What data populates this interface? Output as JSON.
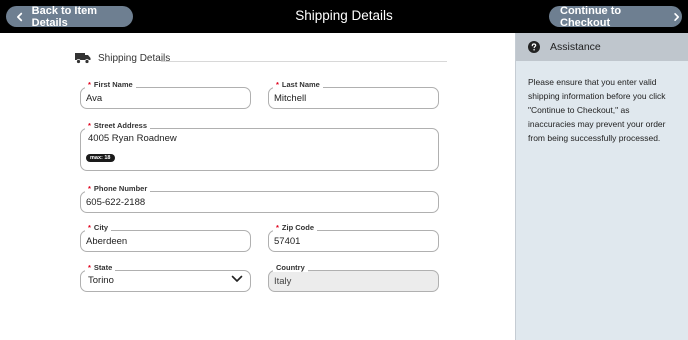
{
  "header": {
    "title": "Shipping Details",
    "back_label": "Back to Item Details",
    "next_label": "Continue to Checkout"
  },
  "form": {
    "section_title": "Shipping Details",
    "first_name": {
      "label": "First Name",
      "value": "Ava",
      "required": true
    },
    "last_name": {
      "label": "Last Name",
      "value": "Mitchell",
      "required": true
    },
    "street_address": {
      "label": "Street Address",
      "value": "4005 Ryan Roadnew",
      "badge": "max: 18",
      "required": true
    },
    "phone_number": {
      "label": "Phone Number",
      "value": "605-622-2188",
      "required": true
    },
    "city": {
      "label": "City",
      "value": "Aberdeen",
      "required": true
    },
    "zip_code": {
      "label": "Zip Code",
      "value": "57401",
      "required": true
    },
    "state": {
      "label": "State",
      "value": "Torino",
      "required": true
    },
    "country": {
      "label": "Country",
      "value": "Italy",
      "required": false
    }
  },
  "assistance": {
    "title": "Assistance",
    "text": "Please ensure that you enter valid shipping information before you click \"Continue to Checkout,\" as inaccuracies may prevent your order from being successfully processed."
  },
  "icons": {
    "back": "chevron-left-icon",
    "next": "chevron-right-icon",
    "section": "truck-icon",
    "assistance": "question-circle-icon",
    "select": "chevron-down-icon"
  },
  "colors": {
    "topbar": "#000000",
    "button": "#6e7f91",
    "required": "#e0001b",
    "sidebar": "#e0e8ee",
    "sidebar_header": "#bfc6cd"
  }
}
